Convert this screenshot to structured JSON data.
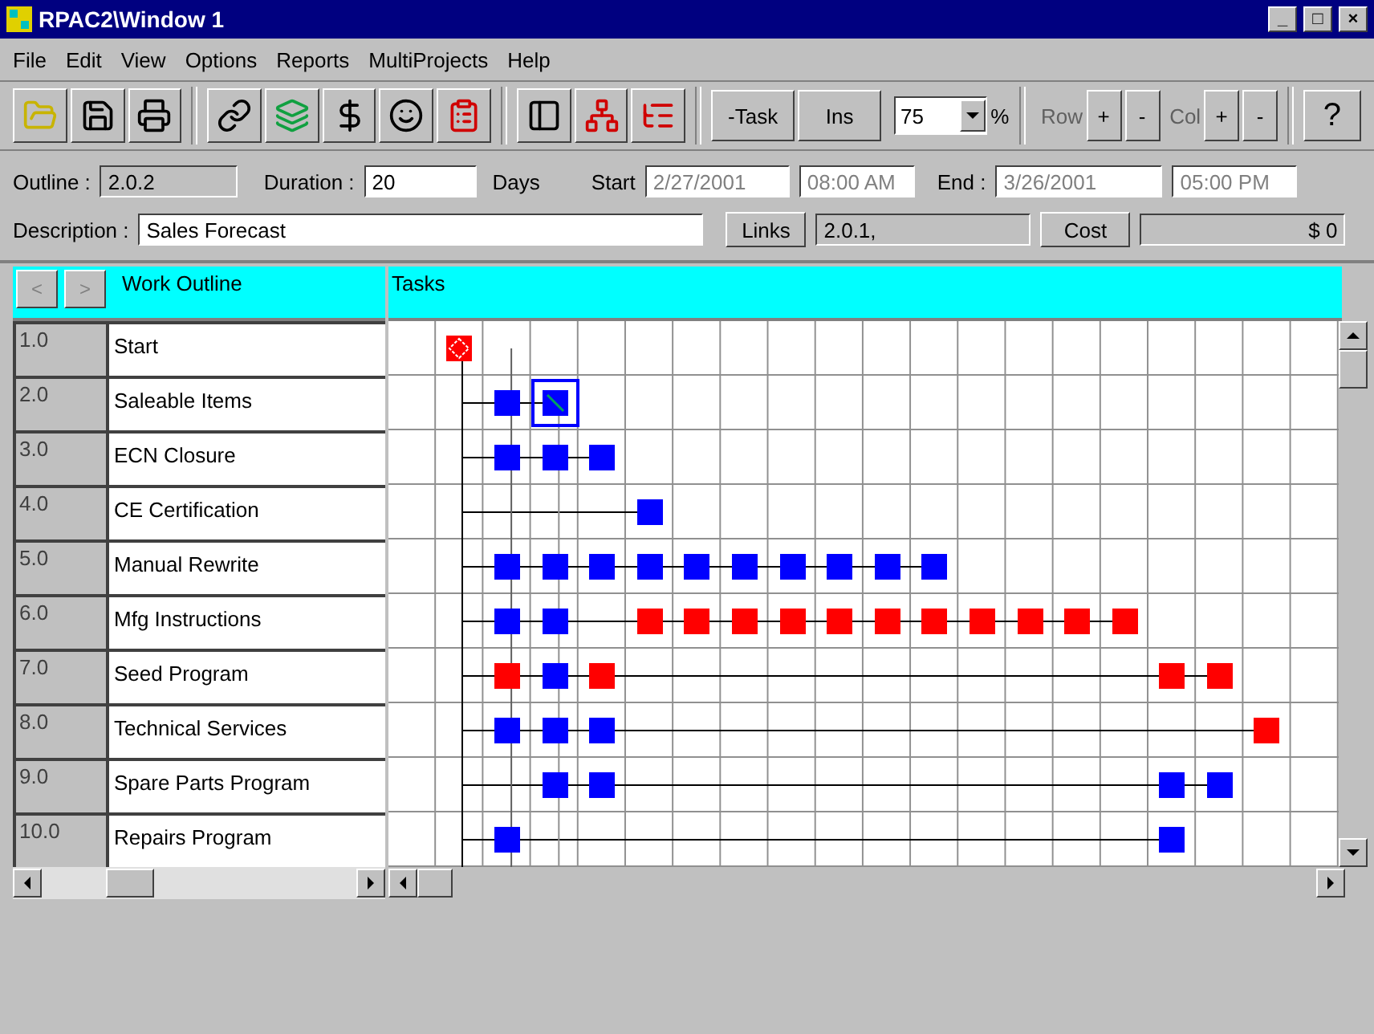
{
  "window": {
    "title": "RPAC2\\Window 1",
    "controls": [
      "_",
      "□",
      "×"
    ]
  },
  "menu": [
    "File",
    "Edit",
    "View",
    "Options",
    "Reports",
    "MultiProjects",
    "Help"
  ],
  "toolbar": {
    "task_buttons": [
      "-Task",
      "Ins"
    ],
    "zoom": {
      "value": "75",
      "unit": "%"
    },
    "row": {
      "label": "Row",
      "buttons": [
        "+",
        "-"
      ]
    },
    "col": {
      "label": "Col",
      "buttons": [
        "+",
        "-"
      ]
    },
    "help": "?"
  },
  "fields": {
    "outline": {
      "label": "Outline :",
      "value": "2.0.2"
    },
    "duration": {
      "label": "Duration :",
      "value": "20",
      "unit": "Days"
    },
    "start": {
      "label": "Start",
      "date": "2/27/2001",
      "time": "08:00 AM"
    },
    "end": {
      "label": "End :",
      "date": "3/26/2001",
      "time": "05:00 PM"
    },
    "description": {
      "label": "Description :",
      "value": "Sales Forecast"
    },
    "links": {
      "button": "Links",
      "value": "2.0.1,"
    },
    "cost": {
      "button": "Cost",
      "value": "$ 0"
    }
  },
  "outline_pane": {
    "nav": [
      "<",
      ">"
    ],
    "header": "Work Outline"
  },
  "tasks_header": "Tasks",
  "rows": [
    {
      "number": "1.0",
      "name": "Start",
      "cells": [
        {
          "kind": "empty"
        },
        {
          "kind": "milestone",
          "color": "#ff0000"
        },
        {
          "kind": "empty"
        },
        {
          "kind": "empty"
        },
        {
          "kind": "empty"
        },
        {
          "kind": "empty"
        },
        {
          "kind": "empty"
        },
        {
          "kind": "empty"
        },
        {
          "kind": "empty"
        },
        {
          "kind": "empty"
        },
        {
          "kind": "empty"
        },
        {
          "kind": "empty"
        },
        {
          "kind": "empty"
        },
        {
          "kind": "empty"
        },
        {
          "kind": "empty"
        },
        {
          "kind": "empty"
        },
        {
          "kind": "empty"
        },
        {
          "kind": "empty"
        },
        {
          "kind": "empty"
        },
        {
          "kind": "empty"
        }
      ]
    },
    {
      "number": "2.0",
      "name": "Saleable Items",
      "cells": [
        {
          "kind": "empty"
        },
        {
          "kind": "empty"
        },
        {
          "kind": "task",
          "color": "#0000ff"
        },
        {
          "kind": "current",
          "color": "#0000ff"
        },
        {
          "kind": "empty"
        },
        {
          "kind": "empty"
        },
        {
          "kind": "empty"
        },
        {
          "kind": "empty"
        },
        {
          "kind": "empty"
        },
        {
          "kind": "empty"
        },
        {
          "kind": "empty"
        },
        {
          "kind": "empty"
        },
        {
          "kind": "empty"
        },
        {
          "kind": "empty"
        },
        {
          "kind": "empty"
        },
        {
          "kind": "empty"
        },
        {
          "kind": "empty"
        },
        {
          "kind": "empty"
        },
        {
          "kind": "empty"
        },
        {
          "kind": "empty"
        }
      ]
    },
    {
      "number": "3.0",
      "name": "ECN Closure",
      "cells": [
        {
          "kind": "empty"
        },
        {
          "kind": "empty"
        },
        {
          "kind": "task",
          "color": "#0000ff"
        },
        {
          "kind": "task",
          "color": "#0000ff"
        },
        {
          "kind": "task",
          "color": "#0000ff"
        },
        {
          "kind": "empty"
        },
        {
          "kind": "empty"
        },
        {
          "kind": "empty"
        },
        {
          "kind": "empty"
        },
        {
          "kind": "empty"
        },
        {
          "kind": "empty"
        },
        {
          "kind": "empty"
        },
        {
          "kind": "empty"
        },
        {
          "kind": "empty"
        },
        {
          "kind": "empty"
        },
        {
          "kind": "empty"
        },
        {
          "kind": "empty"
        },
        {
          "kind": "empty"
        },
        {
          "kind": "empty"
        },
        {
          "kind": "empty"
        }
      ]
    },
    {
      "number": "4.0",
      "name": "CE Certification",
      "cells": [
        {
          "kind": "empty"
        },
        {
          "kind": "empty"
        },
        {
          "kind": "empty"
        },
        {
          "kind": "empty"
        },
        {
          "kind": "empty"
        },
        {
          "kind": "task",
          "color": "#0000ff"
        },
        {
          "kind": "empty"
        },
        {
          "kind": "empty"
        },
        {
          "kind": "empty"
        },
        {
          "kind": "empty"
        },
        {
          "kind": "empty"
        },
        {
          "kind": "empty"
        },
        {
          "kind": "empty"
        },
        {
          "kind": "empty"
        },
        {
          "kind": "empty"
        },
        {
          "kind": "empty"
        },
        {
          "kind": "empty"
        },
        {
          "kind": "empty"
        },
        {
          "kind": "empty"
        },
        {
          "kind": "empty"
        }
      ]
    },
    {
      "number": "5.0",
      "name": "Manual Rewrite",
      "cells": [
        {
          "kind": "empty"
        },
        {
          "kind": "empty"
        },
        {
          "kind": "task",
          "color": "#0000ff"
        },
        {
          "kind": "task",
          "color": "#0000ff"
        },
        {
          "kind": "task",
          "color": "#0000ff"
        },
        {
          "kind": "task",
          "color": "#0000ff"
        },
        {
          "kind": "task",
          "color": "#0000ff"
        },
        {
          "kind": "task",
          "color": "#0000ff"
        },
        {
          "kind": "task",
          "color": "#0000ff"
        },
        {
          "kind": "task",
          "color": "#0000ff"
        },
        {
          "kind": "task",
          "color": "#0000ff"
        },
        {
          "kind": "task",
          "color": "#0000ff"
        },
        {
          "kind": "empty"
        },
        {
          "kind": "empty"
        },
        {
          "kind": "empty"
        },
        {
          "kind": "empty"
        },
        {
          "kind": "empty"
        },
        {
          "kind": "empty"
        },
        {
          "kind": "empty"
        },
        {
          "kind": "empty"
        }
      ]
    },
    {
      "number": "6.0",
      "name": "Mfg Instructions",
      "cells": [
        {
          "kind": "empty"
        },
        {
          "kind": "empty"
        },
        {
          "kind": "task",
          "color": "#0000ff"
        },
        {
          "kind": "task",
          "color": "#0000ff"
        },
        {
          "kind": "empty"
        },
        {
          "kind": "task",
          "color": "#ff0000"
        },
        {
          "kind": "task",
          "color": "#ff0000"
        },
        {
          "kind": "task",
          "color": "#ff0000"
        },
        {
          "kind": "task",
          "color": "#ff0000"
        },
        {
          "kind": "task",
          "color": "#ff0000"
        },
        {
          "kind": "task",
          "color": "#ff0000"
        },
        {
          "kind": "task",
          "color": "#ff0000"
        },
        {
          "kind": "task",
          "color": "#ff0000"
        },
        {
          "kind": "task",
          "color": "#ff0000"
        },
        {
          "kind": "task",
          "color": "#ff0000"
        },
        {
          "kind": "task",
          "color": "#ff0000"
        },
        {
          "kind": "empty"
        },
        {
          "kind": "empty"
        },
        {
          "kind": "empty"
        },
        {
          "kind": "empty"
        }
      ]
    },
    {
      "number": "7.0",
      "name": "Seed Program",
      "cells": [
        {
          "kind": "empty"
        },
        {
          "kind": "empty"
        },
        {
          "kind": "task",
          "color": "#ff0000"
        },
        {
          "kind": "task",
          "color": "#0000ff"
        },
        {
          "kind": "task",
          "color": "#ff0000"
        },
        {
          "kind": "empty"
        },
        {
          "kind": "empty"
        },
        {
          "kind": "empty"
        },
        {
          "kind": "empty"
        },
        {
          "kind": "empty"
        },
        {
          "kind": "empty"
        },
        {
          "kind": "empty"
        },
        {
          "kind": "empty"
        },
        {
          "kind": "empty"
        },
        {
          "kind": "empty"
        },
        {
          "kind": "empty"
        },
        {
          "kind": "task",
          "color": "#ff0000"
        },
        {
          "kind": "task",
          "color": "#ff0000"
        },
        {
          "kind": "empty"
        },
        {
          "kind": "empty"
        }
      ]
    },
    {
      "number": "8.0",
      "name": "Technical Services",
      "cells": [
        {
          "kind": "empty"
        },
        {
          "kind": "empty"
        },
        {
          "kind": "task",
          "color": "#0000ff"
        },
        {
          "kind": "task",
          "color": "#0000ff"
        },
        {
          "kind": "task",
          "color": "#0000ff"
        },
        {
          "kind": "empty"
        },
        {
          "kind": "empty"
        },
        {
          "kind": "empty"
        },
        {
          "kind": "empty"
        },
        {
          "kind": "empty"
        },
        {
          "kind": "empty"
        },
        {
          "kind": "empty"
        },
        {
          "kind": "empty"
        },
        {
          "kind": "empty"
        },
        {
          "kind": "empty"
        },
        {
          "kind": "empty"
        },
        {
          "kind": "empty"
        },
        {
          "kind": "empty"
        },
        {
          "kind": "task",
          "color": "#ff0000"
        },
        {
          "kind": "empty"
        }
      ]
    },
    {
      "number": "9.0",
      "name": "Spare Parts Program",
      "cells": [
        {
          "kind": "empty"
        },
        {
          "kind": "empty"
        },
        {
          "kind": "empty"
        },
        {
          "kind": "task",
          "color": "#0000ff"
        },
        {
          "kind": "task",
          "color": "#0000ff"
        },
        {
          "kind": "empty"
        },
        {
          "kind": "empty"
        },
        {
          "kind": "empty"
        },
        {
          "kind": "empty"
        },
        {
          "kind": "empty"
        },
        {
          "kind": "empty"
        },
        {
          "kind": "empty"
        },
        {
          "kind": "empty"
        },
        {
          "kind": "empty"
        },
        {
          "kind": "empty"
        },
        {
          "kind": "empty"
        },
        {
          "kind": "task",
          "color": "#0000ff"
        },
        {
          "kind": "task",
          "color": "#0000ff"
        },
        {
          "kind": "empty"
        },
        {
          "kind": "empty"
        }
      ]
    },
    {
      "number": "10.0",
      "name": "Repairs Program",
      "cells": [
        {
          "kind": "empty"
        },
        {
          "kind": "empty"
        },
        {
          "kind": "task",
          "color": "#0000ff"
        },
        {
          "kind": "empty"
        },
        {
          "kind": "empty"
        },
        {
          "kind": "empty"
        },
        {
          "kind": "empty"
        },
        {
          "kind": "empty"
        },
        {
          "kind": "empty"
        },
        {
          "kind": "empty"
        },
        {
          "kind": "empty"
        },
        {
          "kind": "empty"
        },
        {
          "kind": "empty"
        },
        {
          "kind": "empty"
        },
        {
          "kind": "empty"
        },
        {
          "kind": "empty"
        },
        {
          "kind": "task",
          "color": "#0000ff"
        },
        {
          "kind": "empty"
        },
        {
          "kind": "empty"
        },
        {
          "kind": "empty"
        }
      ]
    }
  ]
}
